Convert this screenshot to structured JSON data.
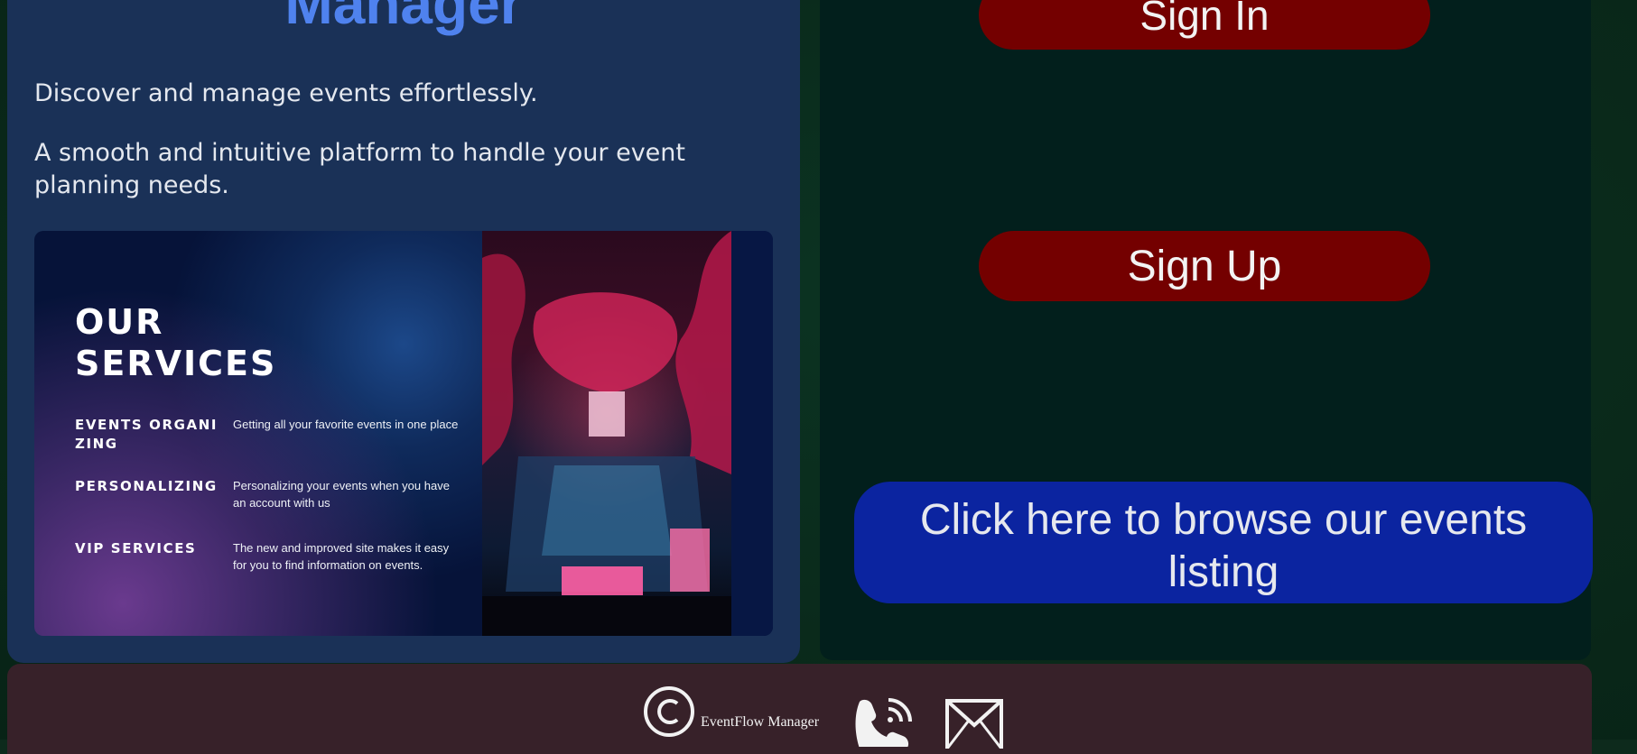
{
  "app": {
    "title": "Manager",
    "tagline_1": "Discover and manage events effortlessly.",
    "tagline_2": "A smooth and intuitive platform to handle your event planning needs."
  },
  "services": {
    "heading": "OUR SERVICES",
    "items": [
      {
        "name": "EVENTS ORGANIZING",
        "description": "Getting all your favorite events in one place"
      },
      {
        "name": "PERSONALIZING",
        "description": "Personalizing your events when you have an account with us"
      },
      {
        "name": "VIP SERVICES",
        "description": "The new and improved site makes it easy for you to find information on events."
      }
    ]
  },
  "auth": {
    "sign_in_label": "Sign In",
    "sign_up_label": "Sign Up"
  },
  "browse": {
    "label": "Click here to browse our events listing"
  },
  "footer": {
    "brand": "EventFlow Manager"
  },
  "colors": {
    "title": "#4f82ee",
    "left_panel": "#1a3157",
    "right_panel": "#021f1c",
    "auth_buttons": "#740000",
    "browse_button": "#0b24a0",
    "footer": "#372129"
  },
  "icons": [
    "copyright-icon",
    "phone-icon",
    "mail-icon"
  ]
}
